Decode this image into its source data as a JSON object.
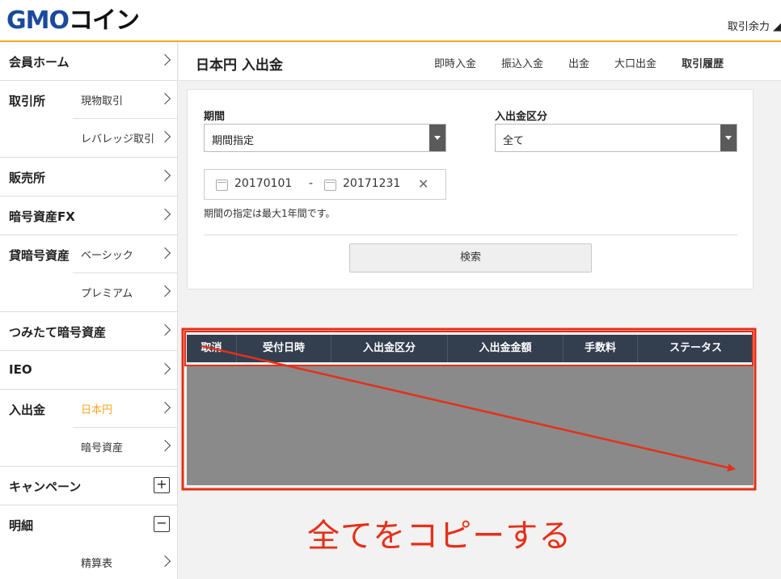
{
  "header": {
    "logo_latin": "GMO",
    "logo_kana": "コイン",
    "balance_label": "取引余力"
  },
  "sidebar": {
    "groups": [
      {
        "label": "会員ホーム",
        "items": []
      },
      {
        "label": "取引所",
        "items": [
          "現物取引",
          "レバレッジ取引"
        ]
      },
      {
        "label": "販売所",
        "items": []
      },
      {
        "label": "暗号資産FX",
        "items": []
      },
      {
        "label": "貸暗号資産",
        "items": [
          "ベーシック",
          "プレミアム"
        ]
      },
      {
        "label": "つみたて暗号資産",
        "items": []
      },
      {
        "label": "IEO",
        "items": []
      },
      {
        "label": "入出金",
        "items": [
          "日本円",
          "暗号資産"
        ],
        "active_item": "日本円"
      },
      {
        "label": "キャンペーン",
        "items": [],
        "icon": "plus"
      },
      {
        "label": "明細",
        "items": [
          "精算表"
        ],
        "icon": "minus"
      }
    ]
  },
  "page": {
    "title": "日本円 入出金",
    "tabs": [
      "即時入金",
      "振込入金",
      "出金",
      "大口出金",
      "取引履歴"
    ],
    "active_tab": "取引履歴"
  },
  "filter": {
    "period_label": "期間",
    "period_value": "期間指定",
    "type_label": "入出金区分",
    "type_value": "全て",
    "date_from": "20170101",
    "date_sep": "-",
    "date_to": "20171231",
    "clear_glyph": "✕",
    "note": "期間の指定は最大1年間です。",
    "search_label": "検索"
  },
  "table": {
    "columns": [
      "取消",
      "受付日時",
      "入出金区分",
      "入出金金額",
      "手数料",
      "ステータス"
    ]
  },
  "annotation": {
    "text": "全てをコピーする",
    "color": "#e53018"
  },
  "colors": {
    "accent": "#f5a623",
    "table_header": "#333e4f",
    "brand_blue": "#1a4a9c"
  }
}
